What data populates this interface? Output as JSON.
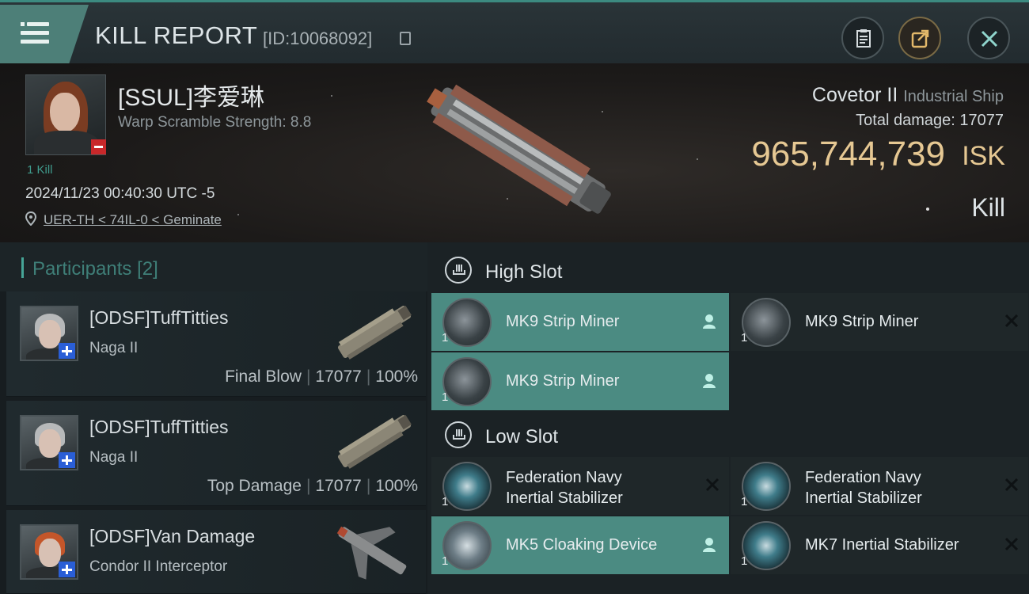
{
  "header": {
    "title": "KILL REPORT",
    "report_id": "[ID:10068092]",
    "icons": [
      "menu-icon",
      "copy-icon",
      "clipboard-icon",
      "share-icon",
      "close-icon"
    ]
  },
  "victim": {
    "name": "[SSUL]李爱琳",
    "warp_scramble": "Warp Scramble Strength: 8.8",
    "kill_count": "1 Kill",
    "datetime": "2024/11/23 00:40:30 UTC -5",
    "location": "UER-TH < 74IL-0 < Geminate",
    "ship_name": "Covetor II",
    "ship_class": "Industrial Ship",
    "total_damage_label": "Total damage:",
    "total_damage": "17077",
    "isk_value": "965,744,739",
    "isk_unit": "ISK",
    "result": "Kill"
  },
  "participants": {
    "label": "Participants",
    "count": "[2]",
    "rows": [
      {
        "name": "[ODSF]TuffTitties",
        "ship": "Naga II",
        "role": "Final Blow",
        "damage": "17077",
        "percent": "100%"
      },
      {
        "name": "[ODSF]TuffTitties",
        "ship": "Naga II",
        "role": "Top Damage",
        "damage": "17077",
        "percent": "100%"
      },
      {
        "name": "[ODSF]Van Damage",
        "ship": "Condor II Interceptor"
      }
    ]
  },
  "slots": {
    "high": {
      "label": "High Slot",
      "modules": [
        {
          "qty": "1",
          "name": "MK9 Strip Miner",
          "status": "person",
          "selected": true
        },
        {
          "qty": "1",
          "name": "MK9 Strip Miner",
          "status": "x",
          "selected": false
        },
        {
          "qty": "1",
          "name": "MK9 Strip Miner",
          "status": "person",
          "selected": true
        }
      ]
    },
    "low": {
      "label": "Low Slot",
      "modules": [
        {
          "qty": "1",
          "name_line1": "Federation Navy",
          "name_line2": "Inertial Stabilizer",
          "status": "x",
          "selected": false
        },
        {
          "qty": "1",
          "name_line1": "Federation Navy",
          "name_line2": "Inertial Stabilizer",
          "status": "x",
          "selected": false
        },
        {
          "qty": "1",
          "name": "MK5 Cloaking Device",
          "status": "person",
          "selected": true
        },
        {
          "qty": "1",
          "name": "MK7 Inertial Stabilizer",
          "status": "x",
          "selected": false
        }
      ]
    }
  },
  "colors": {
    "accent": "#46a597",
    "selected_row": "#4b8b82",
    "isk_gold": "#e6c893",
    "minus_badge": "#c8282a",
    "plus_badge": "#2a5ed6"
  }
}
